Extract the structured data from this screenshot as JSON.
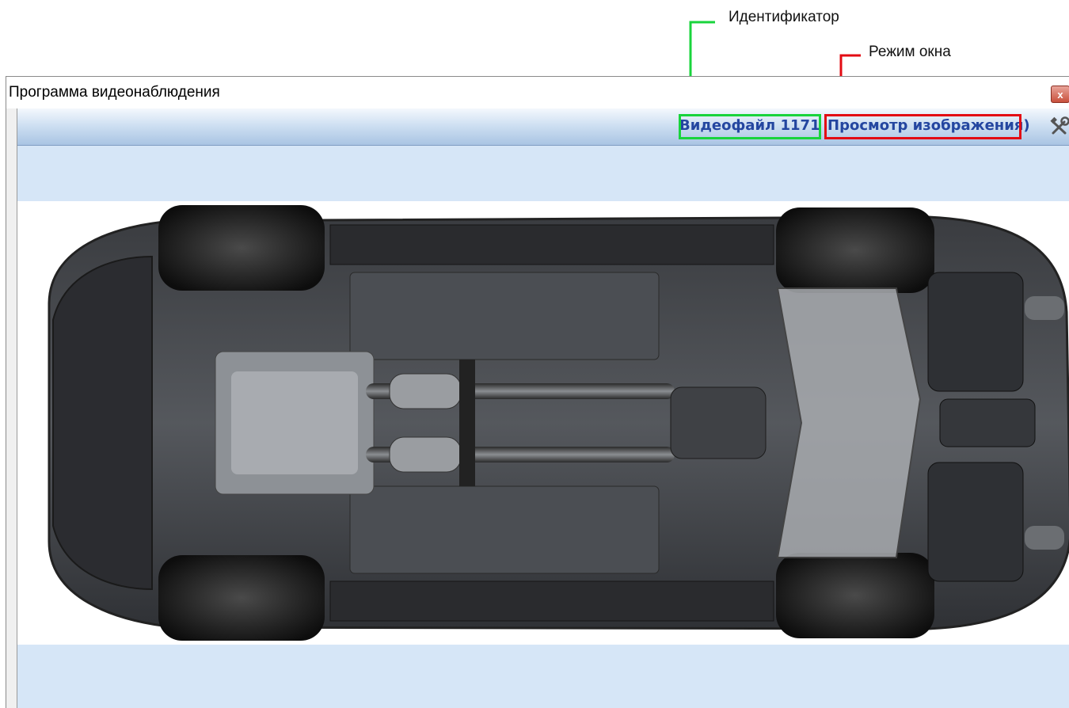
{
  "annotations": {
    "identifier_label": "Идентификатор",
    "window_mode_label": "Режим окна",
    "identifier_color": "#19d43c",
    "window_mode_color": "#e30b13"
  },
  "window": {
    "title": "Программа видеонаблюдения",
    "close_icon": "close-icon",
    "close_glyph": "x"
  },
  "toolbar": {
    "video_file": "Видеофайл 1171",
    "view_mode": "Просмотр изображения)",
    "settings_icon": "tools-icon"
  },
  "viewer": {
    "image": "car-underbody-photo"
  }
}
